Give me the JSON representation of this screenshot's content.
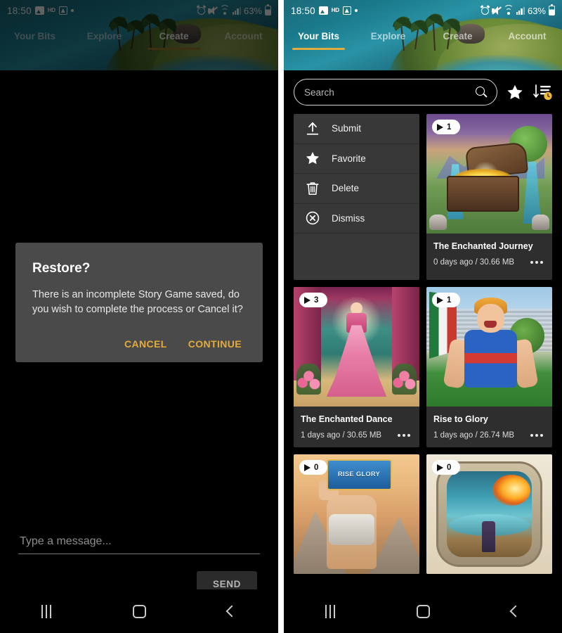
{
  "status_bar": {
    "time": "18:50",
    "battery_percent": "63%",
    "icons": [
      "image-icon",
      "hd-badge-icon",
      "screenshot-icon",
      "dot-icon",
      "alarm-icon",
      "mute-icon",
      "wifi-icon",
      "signal-icon",
      "battery-icon"
    ]
  },
  "tabs": [
    {
      "label": "Your Bits",
      "active_left": false,
      "active_right": true
    },
    {
      "label": "Explore",
      "active_left": false,
      "active_right": false
    },
    {
      "label": "Create",
      "active_left": true,
      "active_right": false
    },
    {
      "label": "Account",
      "active_left": false,
      "active_right": false
    }
  ],
  "left_panel": {
    "dialog": {
      "title": "Restore?",
      "message": "There is an incomplete Story Game saved, do you wish to complete the process or Cancel it?",
      "cancel_label": "CANCEL",
      "continue_label": "CONTINUE"
    },
    "message_input_placeholder": "Type a message...",
    "message_input_value": "",
    "send_label": "SEND"
  },
  "right_panel": {
    "search": {
      "placeholder": "Search",
      "value": ""
    },
    "toolbar_icons": [
      "favorite-star-icon",
      "sort-by-recent-icon"
    ],
    "context_menu": [
      {
        "label": "Submit",
        "icon": "upload-icon"
      },
      {
        "label": "Favorite",
        "icon": "star-icon"
      },
      {
        "label": "Delete",
        "icon": "trash-icon"
      },
      {
        "label": "Dismiss",
        "icon": "close-circle-icon"
      }
    ],
    "cards": [
      {
        "title": "The Enchanted Journey",
        "meta": "0 days ago / 30.66 MB",
        "play_count": "1",
        "art": "art-journey"
      },
      {
        "title": "The Enchanted Dance",
        "meta": "1 days ago / 30.65 MB",
        "play_count": "3",
        "art": "art-dance"
      },
      {
        "title": "Rise to Glory",
        "meta": "1 days ago / 26.74 MB",
        "play_count": "1",
        "art": "art-glory"
      },
      {
        "title": "",
        "meta": "",
        "play_count": "0",
        "art": "art-riseglory",
        "logo_text": "RISE GLORY"
      },
      {
        "title": "",
        "meta": "",
        "play_count": "0",
        "art": "art-cave"
      }
    ]
  },
  "nav_bar": {
    "recent_label": "recent-apps",
    "home_label": "home",
    "back_label": "back"
  },
  "colors": {
    "accent": "#e0ab3f",
    "accent_dim": "#a07f2e",
    "dialog_bg": "#4a4a4a",
    "card_bg": "#2e2e2e",
    "menu_bg": "#383838",
    "page_bg": "#000000"
  }
}
